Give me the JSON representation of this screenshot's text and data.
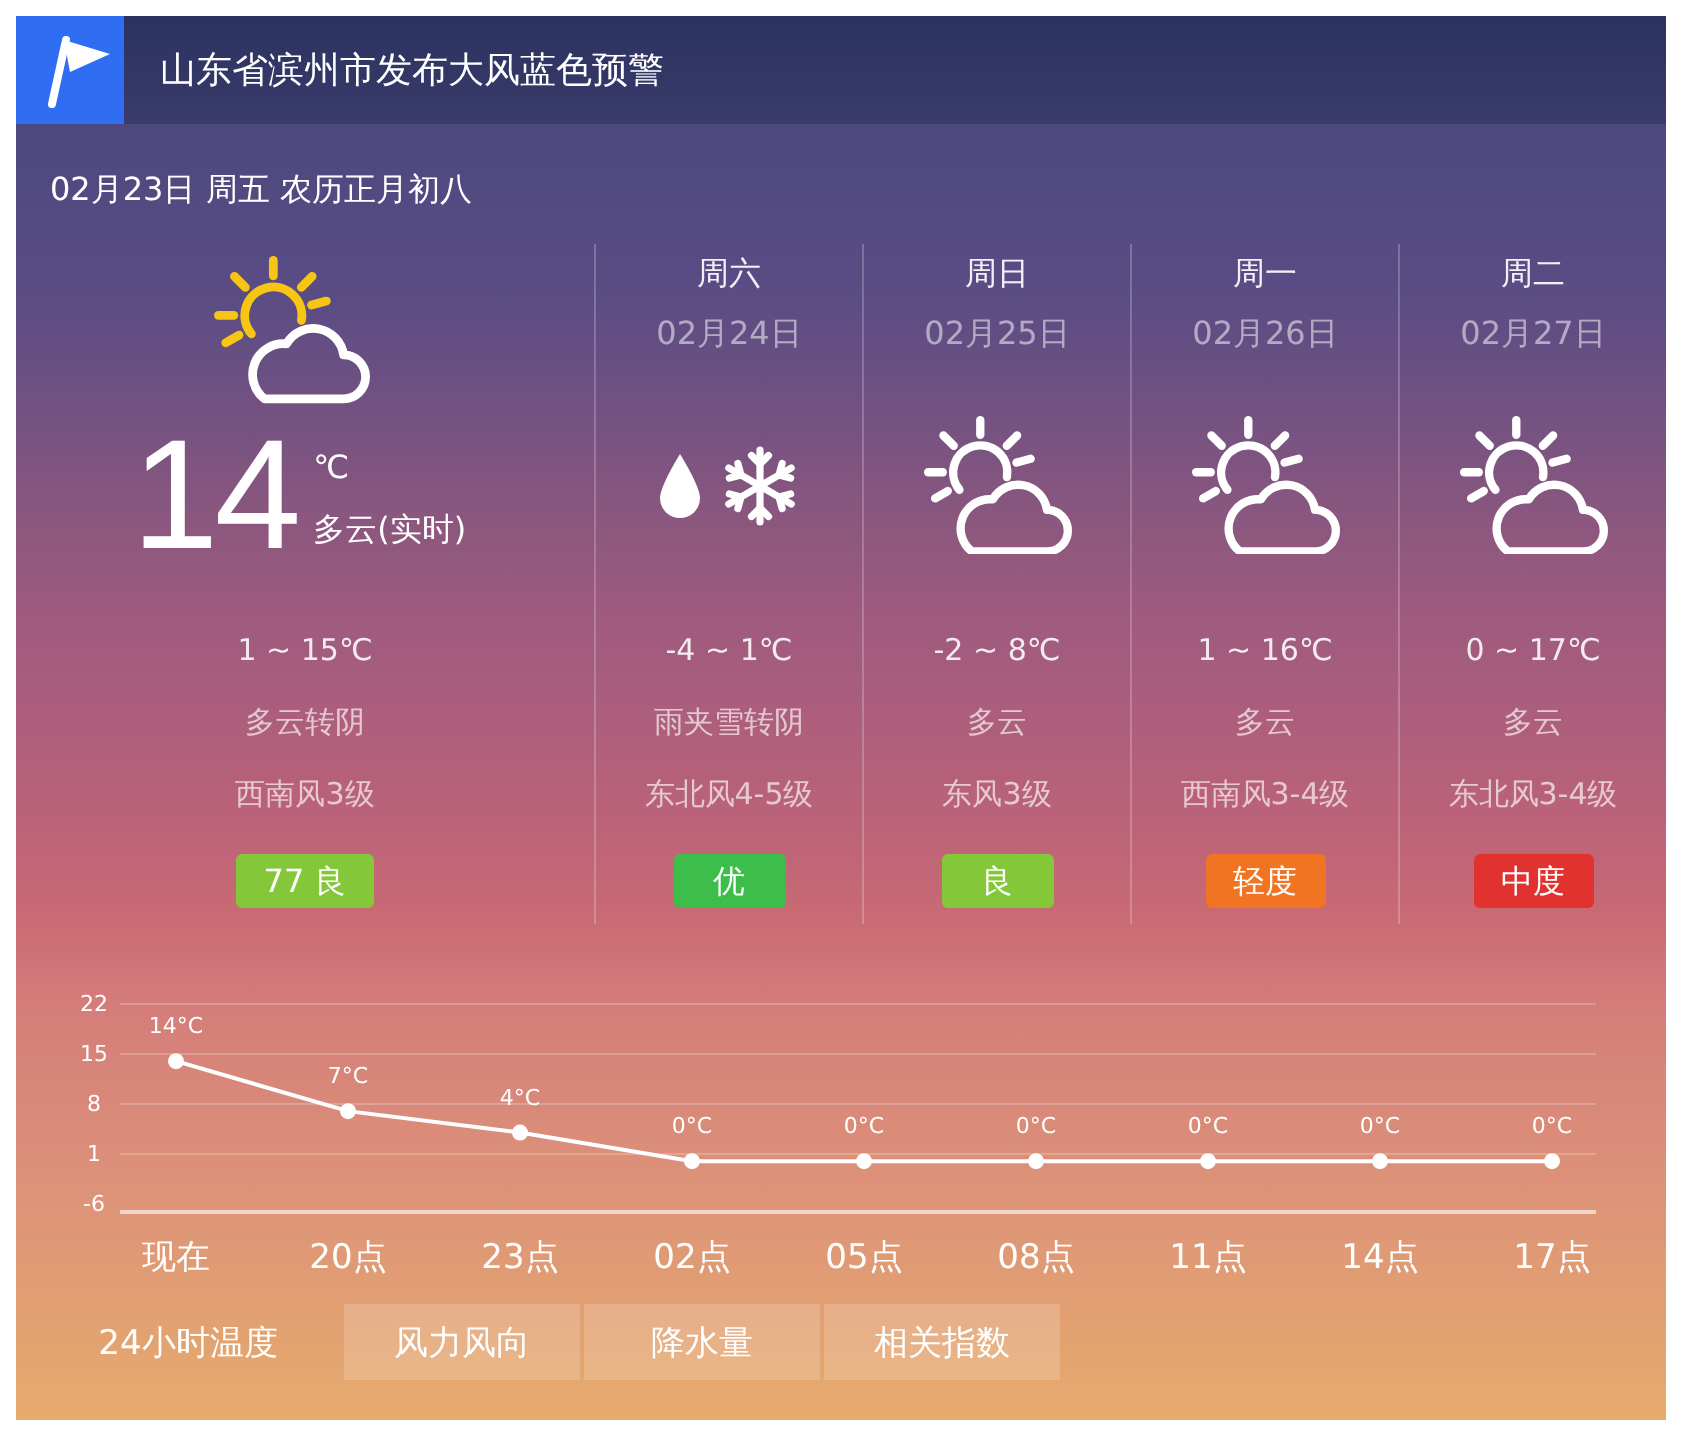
{
  "alert": {
    "title": "山东省滨州市发布大风蓝色预警"
  },
  "date_line": "02月23日 周五 农历正月初八",
  "today": {
    "temperature": "14",
    "unit": "℃",
    "condition": "多云(实时)",
    "range": "1 ~ 15℃",
    "sky": "多云转阴",
    "wind": "西南风3级",
    "aqi": {
      "label": "77 良",
      "color": "#84c83a"
    }
  },
  "forecast": [
    {
      "day": "周六",
      "date": "02月24日",
      "kind": "sleet",
      "range": "-4 ~ 1℃",
      "sky": "雨夹雪转阴",
      "wind": "东北风4-5级",
      "aqi": {
        "label": "优",
        "color": "#3dbd4a"
      }
    },
    {
      "day": "周日",
      "date": "02月25日",
      "kind": "partly_cloudy",
      "range": "-2 ~ 8℃",
      "sky": "多云",
      "wind": "东风3级",
      "aqi": {
        "label": "良",
        "color": "#84c83a"
      }
    },
    {
      "day": "周一",
      "date": "02月26日",
      "kind": "partly_cloudy",
      "range": "1 ~ 16℃",
      "sky": "多云",
      "wind": "西南风3-4级",
      "aqi": {
        "label": "轻度",
        "color": "#f07422"
      }
    },
    {
      "day": "周二",
      "date": "02月27日",
      "kind": "partly_cloudy",
      "range": "0 ~ 17℃",
      "sky": "多云",
      "wind": "东北风3-4级",
      "aqi": {
        "label": "中度",
        "color": "#e2322f"
      }
    }
  ],
  "hourly": {
    "chart_data": {
      "type": "line",
      "categories": [
        "现在",
        "20点",
        "23点",
        "02点",
        "05点",
        "08点",
        "11点",
        "14点",
        "17点"
      ],
      "series": [
        {
          "color": "#ffffff",
          "marker": "circle",
          "values": [
            14,
            7,
            4,
            0,
            0,
            0,
            0,
            0,
            0
          ]
        }
      ],
      "ylim": [
        -6,
        22
      ],
      "yticks": [
        22,
        15,
        8,
        1,
        -6
      ],
      "grid": true,
      "value_labels": [
        "14°C",
        "7°C",
        "4°C",
        "0°C",
        "0°C",
        "0°C",
        "0°C",
        "0°C",
        "0°C"
      ]
    }
  },
  "tabs": [
    {
      "label": "24小时温度",
      "selected": true
    },
    {
      "label": "风力风向",
      "selected": false
    },
    {
      "label": "降水量",
      "selected": false
    },
    {
      "label": "相关指数",
      "selected": false
    }
  ]
}
